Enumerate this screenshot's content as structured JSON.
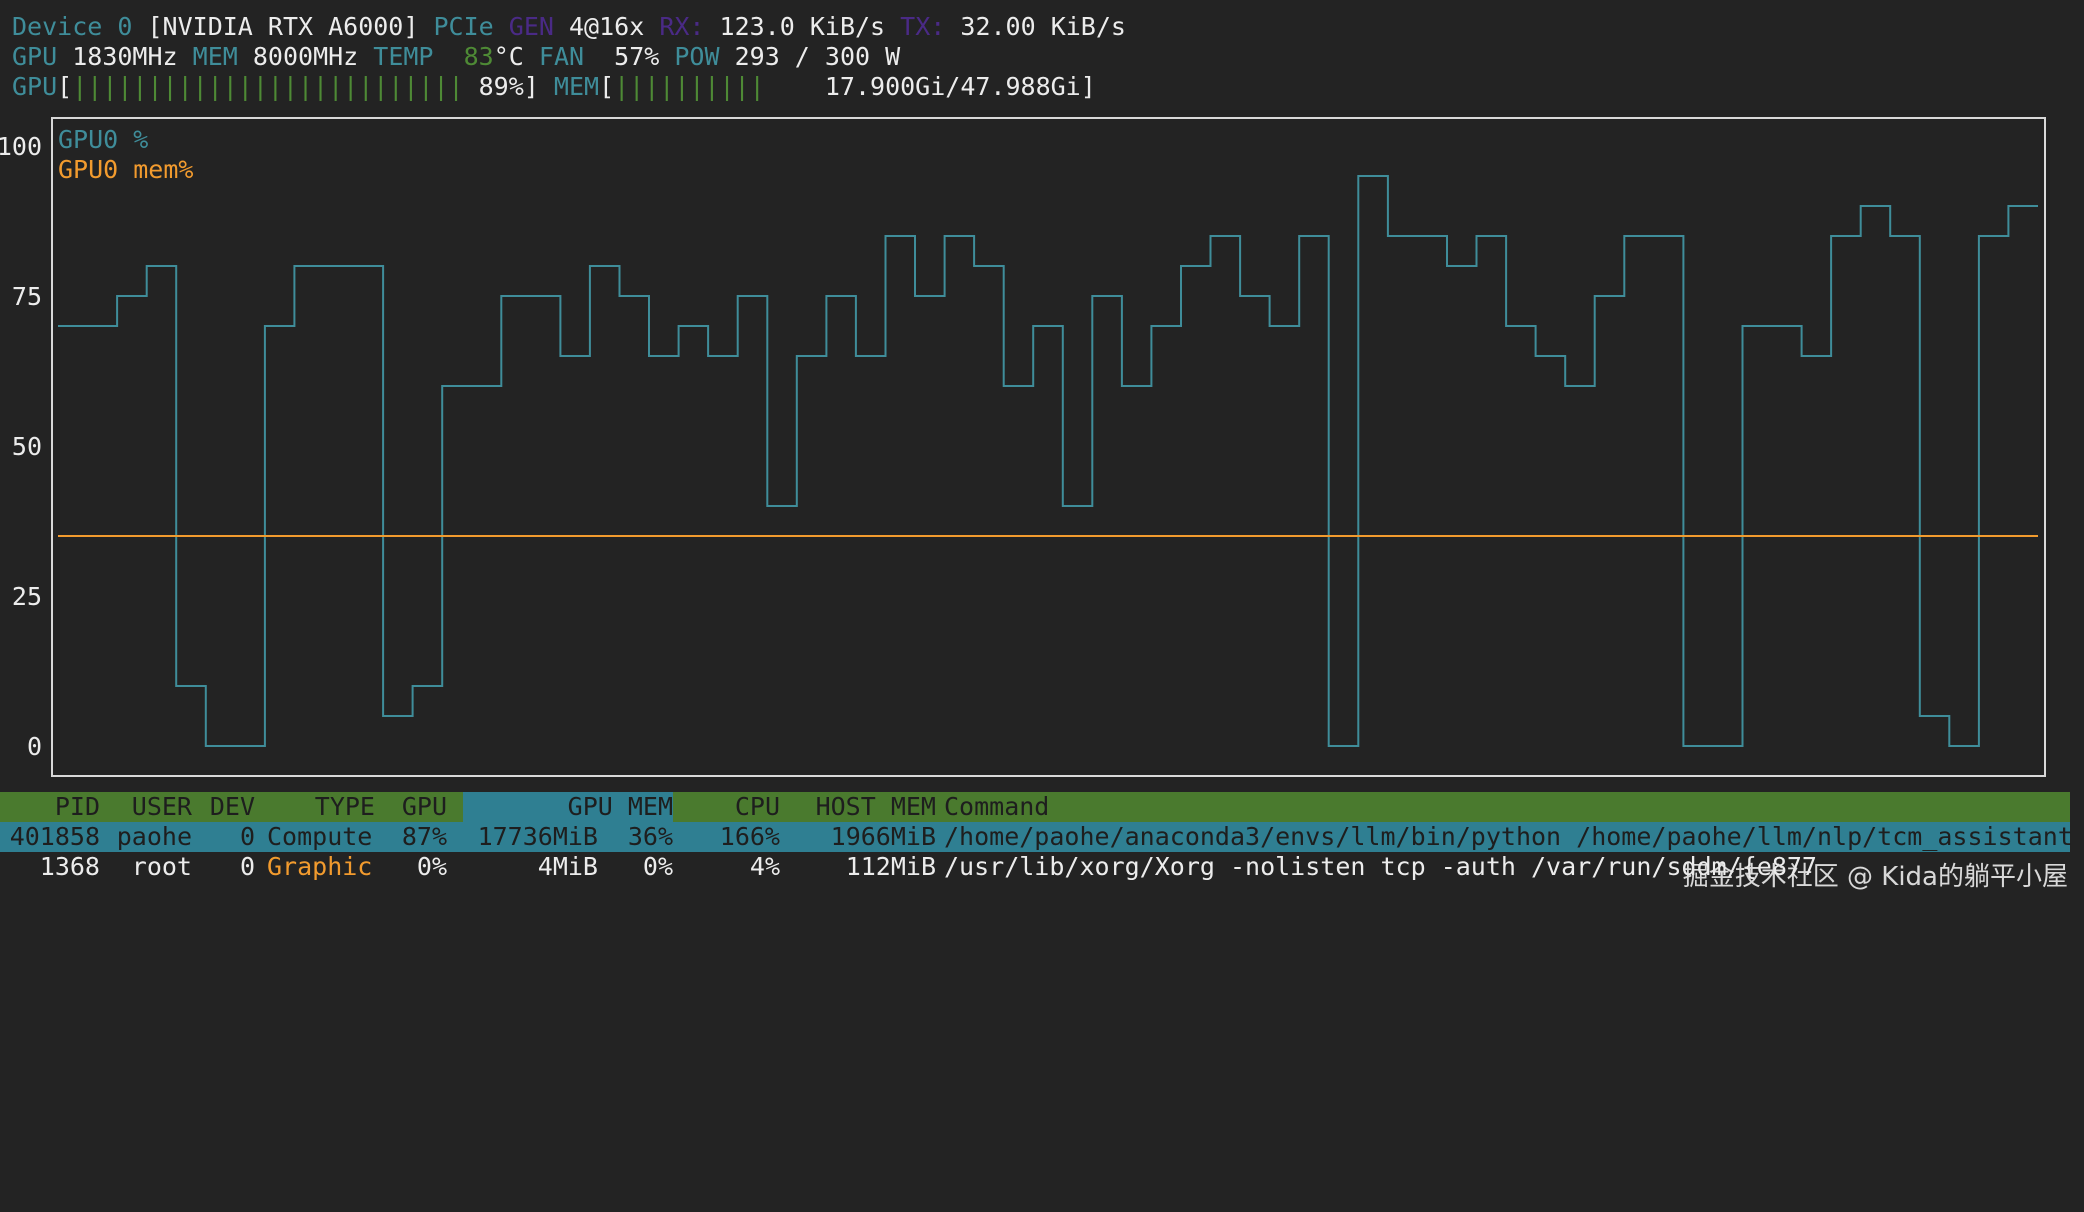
{
  "header": {
    "device_label": "Device 0",
    "device_name": "[NVIDIA RTX A6000]",
    "pcie_label": "PCIe",
    "gen_label": "GEN",
    "gen_value": "4@16x",
    "rx_label": "RX:",
    "rx_value": "123.0 KiB/s",
    "tx_label": "TX:",
    "tx_value": "32.00 KiB/s",
    "gpu_label": "GPU",
    "gpu_clock": "1830MHz",
    "mem_label": "MEM",
    "mem_clock": "8000MHz",
    "temp_label": "TEMP",
    "temp_value": "83",
    "temp_unit": "°C",
    "fan_label": "FAN",
    "fan_value": "57%",
    "pow_label": "POW",
    "pow_value": "293 / 300 W",
    "gpu_bar_label": "GPU",
    "gpu_bar_open": "[",
    "gpu_bar_fill": "||||||||||||||||||||||||||",
    "gpu_bar_pct": "89%]",
    "mem_bar_label": "MEM",
    "mem_bar_open": "[",
    "mem_bar_fill": "||||||||||",
    "mem_bar_value": "17.900Gi/47.988Gi]",
    "gpu_util_fraction": 0.89,
    "mem_used_fraction": 0.373
  },
  "chart_data": {
    "type": "line",
    "y_ticks": [
      "100",
      "75",
      "50",
      "25",
      "0"
    ],
    "ylim": [
      0,
      100
    ],
    "series": [
      {
        "name": "GPU0 %",
        "color": "#3f8d9a",
        "values": [
          70,
          70,
          75,
          80,
          10,
          0,
          0,
          70,
          80,
          80,
          80,
          5,
          10,
          60,
          60,
          75,
          75,
          65,
          80,
          75,
          65,
          70,
          65,
          75,
          40,
          65,
          75,
          65,
          85,
          75,
          85,
          80,
          60,
          70,
          40,
          75,
          60,
          70,
          80,
          85,
          75,
          70,
          85,
          0,
          95,
          85,
          85,
          80,
          85,
          70,
          65,
          60,
          75,
          85,
          85,
          0,
          0,
          70,
          70,
          65,
          85,
          90,
          85,
          5,
          0,
          85,
          90
        ]
      },
      {
        "name": "GPU0 mem%",
        "color": "#f29b2e",
        "values": [
          35,
          35,
          35,
          35,
          35,
          35,
          35,
          35,
          35,
          35,
          35,
          35,
          35,
          35,
          35,
          35,
          35,
          35,
          35,
          35,
          35,
          35,
          35,
          35,
          35,
          35,
          35,
          35,
          35,
          35,
          35,
          35,
          35,
          35,
          35,
          35,
          35,
          35,
          35,
          35,
          35,
          35,
          35,
          35,
          35,
          35,
          35,
          35,
          35,
          35,
          35,
          35,
          35,
          35,
          35,
          35,
          35,
          35,
          35,
          35,
          35,
          35,
          35,
          35,
          35,
          35,
          35
        ]
      }
    ]
  },
  "processes": {
    "headers": [
      "PID",
      "USER",
      "DEV",
      "TYPE",
      "GPU",
      "GPU MEM",
      "",
      "CPU",
      "HOST MEM",
      "Command"
    ],
    "rows": [
      [
        "401858",
        "paohe",
        "0",
        "Compute",
        "87%",
        "17736MiB",
        "36%",
        "166%",
        "1966MiB",
        "/home/paohe/anaconda3/envs/llm/bin/python /home/paohe/llm/nlp/tcm_assistant"
      ],
      [
        "1368",
        "root",
        "0",
        "Graphic",
        "0%",
        "4MiB",
        "0%",
        "4%",
        "112MiB",
        "/usr/lib/xorg/Xorg -nolisten tcp -auth /var/run/sddm/{e877"
      ]
    ]
  },
  "watermark": "掘金技术社区 @ Kida的躺平小屋"
}
